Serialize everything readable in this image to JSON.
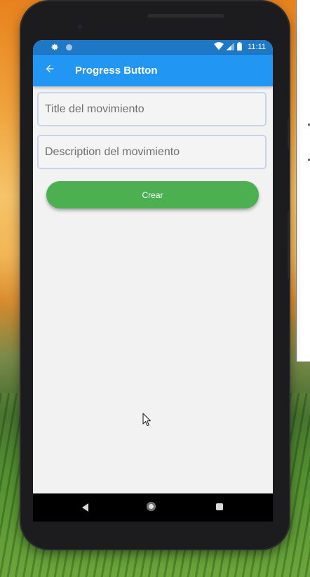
{
  "status_bar": {
    "time": "11:11",
    "icons_left": [
      "settings-gear-icon",
      "circle-status-icon"
    ],
    "icons_right": [
      "wifi-icon",
      "signal-icon",
      "battery-icon"
    ],
    "bg_color": "#1e78c6"
  },
  "app_bar": {
    "back_icon": "arrow-left-icon",
    "title": "Progress Button",
    "bg_color": "#2196f3"
  },
  "form": {
    "title_field": {
      "placeholder": "Title del movimiento",
      "value": ""
    },
    "description_field": {
      "placeholder": "Description del movimiento",
      "value": ""
    },
    "create_button": {
      "label": "Crear",
      "color": "#4caf50"
    }
  },
  "nav_bar": {
    "buttons": [
      "back-triangle-icon",
      "home-circle-icon",
      "recents-square-icon"
    ]
  }
}
